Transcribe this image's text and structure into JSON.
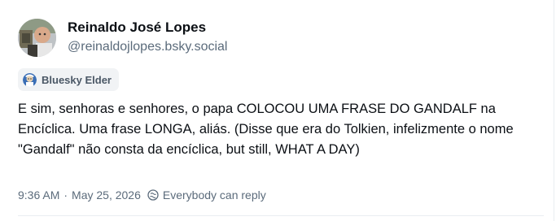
{
  "author": {
    "display_name": "Reinaldo José Lopes",
    "handle": "@reinaldojlopes.bsky.social",
    "avatar_icon": "user-avatar"
  },
  "badge": {
    "label": "Bluesky Elder",
    "icon": "elder-badge-icon"
  },
  "post": {
    "text": "E sim, senhoras e senhores, o papa COLOCOU UMA FRASE DO GANDALF na Encíclica. Uma frase LONGA, aliás. (Disse que era do Tolkien, infelizmente o nome \"Gandalf\" não consta da encíclica, but still, WHAT A DAY)"
  },
  "meta": {
    "time": "9:36 AM",
    "separator": "·",
    "date": "May 25, 2026",
    "reply_setting": "Everybody can reply",
    "reply_icon": "globe-icon"
  },
  "colors": {
    "text": "#0b0f14",
    "muted": "#5b6b7b",
    "badge_bg": "#f1f3f5"
  }
}
